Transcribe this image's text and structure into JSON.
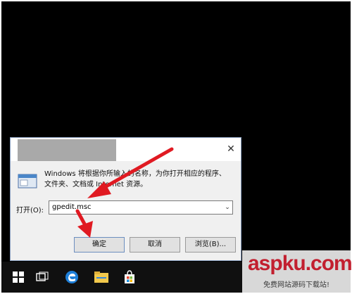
{
  "dialog": {
    "close_glyph": "✕",
    "description": "Windows 将根据你所输入的名称，为你打开相应的程序、\n文件夹、文档或 Internet 资源。",
    "open_label": "打开(O):",
    "input_value": "gpedit.msc",
    "dropdown_glyph": "⌄",
    "buttons": {
      "ok": "确定",
      "cancel": "取消",
      "browse": "浏览(B)..."
    }
  },
  "taskbar": {
    "icons": [
      "windows-start-icon",
      "task-view-icon",
      "edge-icon",
      "file-explorer-icon",
      "store-icon"
    ]
  },
  "watermark": {
    "logo": "aspku.com",
    "subtitle": "免费网站源码下载站!"
  },
  "colors": {
    "arrow": "#e01a22",
    "desktop": "#000000",
    "taskbar": "#101010"
  }
}
